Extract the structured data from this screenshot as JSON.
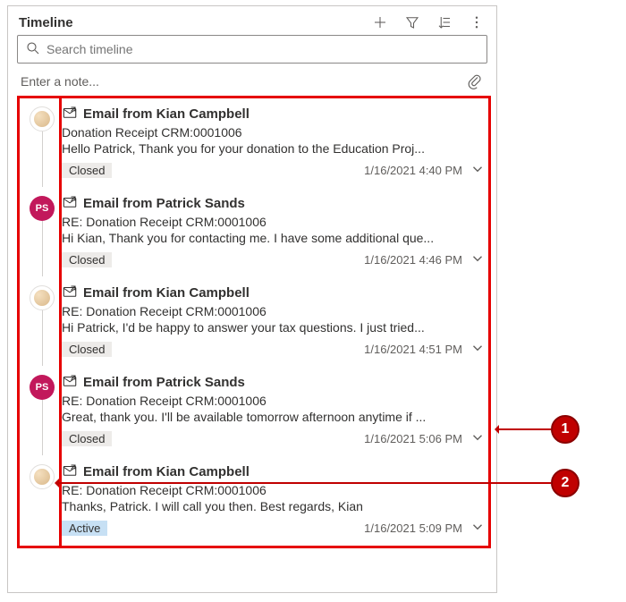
{
  "header": {
    "title": "Timeline"
  },
  "search": {
    "placeholder": "Search timeline"
  },
  "note": {
    "placeholder": "Enter a note..."
  },
  "items": [
    {
      "avatar_type": "kc",
      "avatar_text": "",
      "title": "Email from Kian Campbell",
      "subject": "Donation Receipt CRM:0001006",
      "preview": "Hello Patrick,   Thank you for your donation to the Education Proj...",
      "status": "Closed",
      "status_class": "",
      "timestamp": "1/16/2021 4:40 PM"
    },
    {
      "avatar_type": "ps",
      "avatar_text": "PS",
      "title": "Email from Patrick Sands",
      "subject": "RE: Donation Receipt CRM:0001006",
      "preview": "Hi Kian, Thank you for contacting me. I have some additional que...",
      "status": "Closed",
      "status_class": "",
      "timestamp": "1/16/2021 4:46 PM"
    },
    {
      "avatar_type": "kc",
      "avatar_text": "",
      "title": "Email from Kian Campbell",
      "subject": "RE: Donation Receipt CRM:0001006",
      "preview": "Hi Patrick,   I'd be happy to answer your tax questions. I just tried...",
      "status": "Closed",
      "status_class": "",
      "timestamp": "1/16/2021 4:51 PM"
    },
    {
      "avatar_type": "ps",
      "avatar_text": "PS",
      "title": "Email from Patrick Sands",
      "subject": "RE: Donation Receipt CRM:0001006",
      "preview": "Great, thank you. I'll be available tomorrow afternoon anytime if ...",
      "status": "Closed",
      "status_class": "",
      "timestamp": "1/16/2021 5:06 PM"
    },
    {
      "avatar_type": "kc",
      "avatar_text": "",
      "title": "Email from Kian Campbell",
      "subject": "RE: Donation Receipt CRM:0001006",
      "preview": "Thanks, Patrick. I will call you then.   Best regards, Kian",
      "status": "Active",
      "status_class": "active",
      "timestamp": "1/16/2021 5:09 PM"
    }
  ],
  "callouts": [
    {
      "num": "1"
    },
    {
      "num": "2"
    }
  ]
}
